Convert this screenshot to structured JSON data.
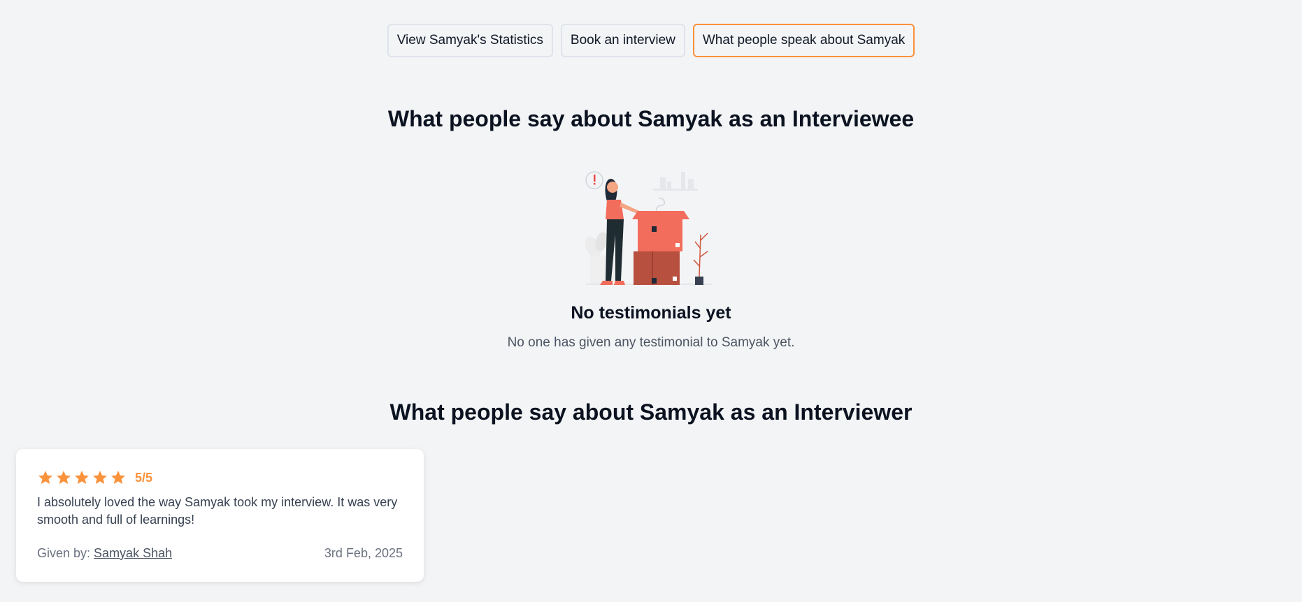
{
  "tabs": [
    {
      "label": "View Samyak's Statistics",
      "active": false
    },
    {
      "label": "Book an interview",
      "active": false
    },
    {
      "label": "What people speak about Samyak",
      "active": true
    }
  ],
  "interviewee_section": {
    "title": "What people say about Samyak as an Interviewee",
    "empty_state": {
      "illustration": "woman-with-empty-boxes-illustration",
      "title": "No testimonials yet",
      "description": "No one has given any testimonial to Samyak yet."
    }
  },
  "interviewer_section": {
    "title": "What people say about Samyak as an Interviewer",
    "testimonials": [
      {
        "stars": 5,
        "rating_text": "5/5",
        "text": "I absolutely loved the way Samyak took my interview. It was very smooth and full of learnings!",
        "given_by_label": "Given by:",
        "given_by_name": "Samyak Shah",
        "date": "3rd Feb, 2025"
      }
    ]
  },
  "colors": {
    "accent": "#fb923c",
    "background": "#f3f4f6",
    "card": "#ffffff"
  }
}
